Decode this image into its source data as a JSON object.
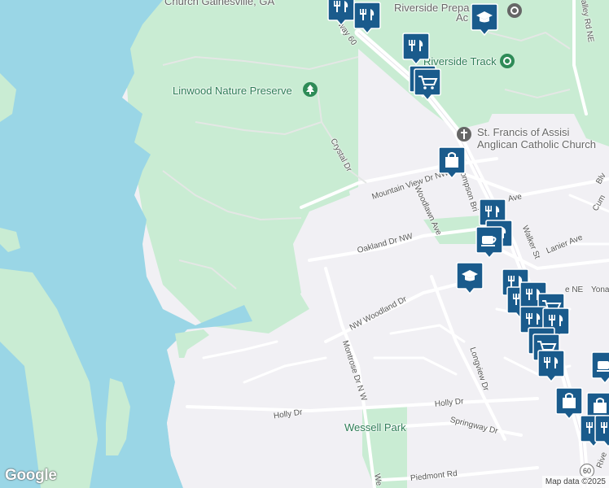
{
  "map": {
    "labels": {
      "church_gainesville": "Church Gainesville, GA",
      "riverside_prep": "Riverside Prepa",
      "riverside_prep_2": "Ac",
      "riverside_track": "Riverside Track",
      "linwood": "Linwood Nature Preserve",
      "st_francis_1": "St. Francis of Assisi",
      "st_francis_2": "Anglican Catholic Church",
      "wessell_park": "Wessell Park"
    },
    "streets": {
      "hwy60": "way 60",
      "crystal_dr": "Crystal Dr",
      "mountain_view": "Mountain View Dr NW",
      "woodlawn": "Woodlawn Ave",
      "thompson_bridge": "ompson Bri",
      "oakland": "Oakland Dr NW",
      "ave": "Ave",
      "walker_st": "Walker St",
      "lanier_ave": "Lanier Ave",
      "nw_woodland": "NW Woodland Dr",
      "montrose": "Montrose Dr N W",
      "longview": "Longview Dr",
      "holly_dr_left": "Holly Dr",
      "holly_dr_right": "Holly Dr",
      "springway": "Springway Dr",
      "piedmont": "Piedmont Rd",
      "valley_rd": "alley Rd NE",
      "blv": "Blv",
      "cum": "Cum",
      "yona": "Yona",
      "ne": "e NE",
      "we": "We",
      "rive": "Rive"
    },
    "shield": "60",
    "logo": "Google",
    "attribution": "Map data ©2025",
    "colors": {
      "water": "#9ad6e6",
      "park": "#c9ecd3",
      "land": "#f1f0f4",
      "road": "#ffffff",
      "marker": "#1a5b8c"
    }
  }
}
